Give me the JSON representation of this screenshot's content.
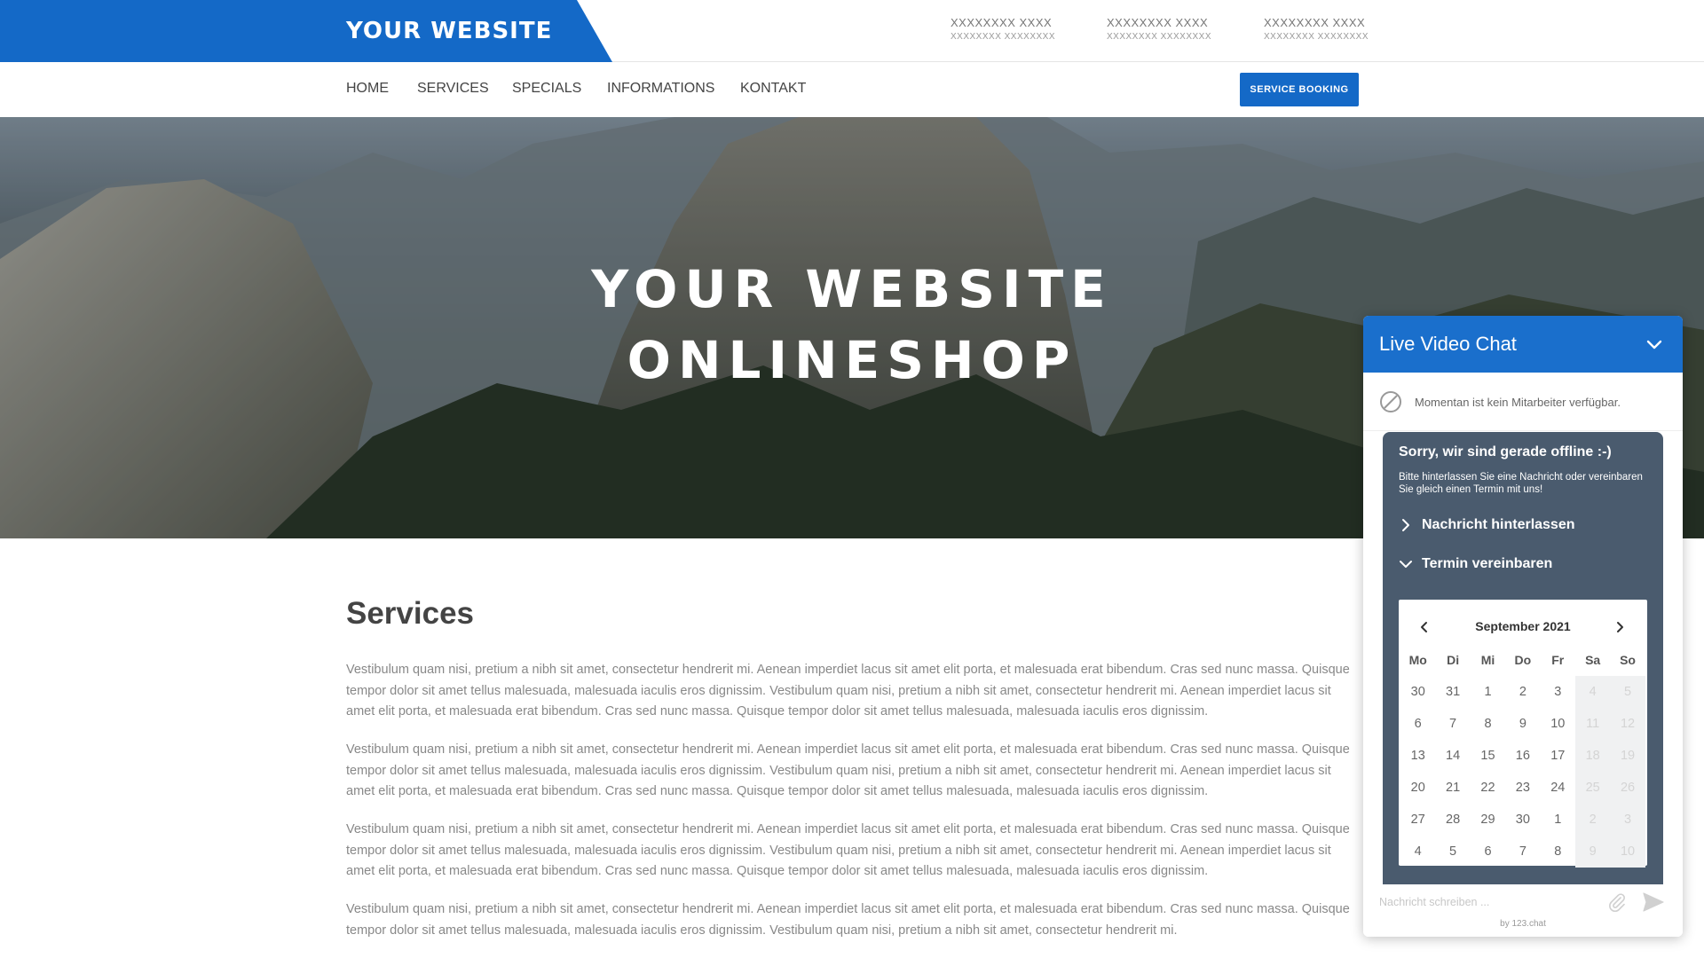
{
  "header": {
    "brand": "YOUR WEBSITE",
    "brand_color": "#1469c7",
    "contacts": [
      {
        "title": "XXXXXXXX XXXX",
        "sub": "XXXXXXXX XXXXXXXX"
      },
      {
        "title": "XXXXXXXX XXXX",
        "sub": "XXXXXXXX XXXXXXXX"
      },
      {
        "title": "XXXXXXXX XXXX",
        "sub": "XXXXXXXX XXXXXXXX"
      }
    ]
  },
  "nav": {
    "items": [
      "HOME",
      "SERVICES",
      "SPECIALS",
      "INFORMATIONS",
      "KONTAKT"
    ],
    "booking_button": "SERVICE BOOKING"
  },
  "hero": {
    "line1": "YOUR WEBSITE",
    "line2": "ONLINESHOP"
  },
  "content": {
    "title": "Services",
    "paragraphs": [
      "Vestibulum quam nisi, pretium a nibh sit amet, consectetur hendrerit mi. Aenean imperdiet lacus sit amet elit porta, et malesuada erat bibendum. Cras sed nunc massa. Quisque tempor dolor sit amet tellus malesuada, malesuada iaculis eros dignissim. Vestibulum quam nisi, pretium a nibh sit amet, consectetur hendrerit mi. Aenean imperdiet lacus sit amet elit porta, et malesuada erat bibendum. Cras sed nunc massa. Quisque tempor dolor sit amet tellus malesuada, malesuada iaculis eros dignissim.",
      "Vestibulum quam nisi, pretium a nibh sit amet, consectetur hendrerit mi. Aenean imperdiet lacus sit amet elit porta, et malesuada erat bibendum. Cras sed nunc massa. Quisque tempor dolor sit amet tellus malesuada, malesuada iaculis eros dignissim. Vestibulum quam nisi, pretium a nibh sit amet, consectetur hendrerit mi. Aenean imperdiet lacus sit amet elit porta, et malesuada erat bibendum. Cras sed nunc massa. Quisque tempor dolor sit amet tellus malesuada, malesuada iaculis eros dignissim.",
      "Vestibulum quam nisi, pretium a nibh sit amet, consectetur hendrerit mi. Aenean imperdiet lacus sit amet elit porta, et malesuada erat bibendum. Cras sed nunc massa. Quisque tempor dolor sit amet tellus malesuada, malesuada iaculis eros dignissim. Vestibulum quam nisi, pretium a nibh sit amet, consectetur hendrerit mi. Aenean imperdiet lacus sit amet elit porta, et malesuada erat bibendum. Cras sed nunc massa. Quisque tempor dolor sit amet tellus malesuada, malesuada iaculis eros dignissim.",
      "Vestibulum quam nisi, pretium a nibh sit amet, consectetur hendrerit mi. Aenean imperdiet lacus sit amet elit porta, et malesuada erat bibendum. Cras sed nunc massa. Quisque tempor dolor sit amet tellus malesuada, malesuada iaculis eros dignissim. Vestibulum quam nisi, pretium a nibh sit amet, consectetur hendrerit mi."
    ]
  },
  "chat": {
    "title": "Live Video Chat",
    "header_color": "#1a6fcc",
    "status_text": "Momentan ist kein Mitarbeiter verfügbar.",
    "offline_title": "Sorry, wir sind gerade offline :-)",
    "offline_sub": "Bitte hinterlassen Sie eine Nachricht oder vereinbaren Sie gleich einen Termin mit uns!",
    "option_message": "Nachricht hinterlassen",
    "option_appointment": "Termin vereinbaren",
    "input_placeholder": "Nachricht schreiben ...",
    "powered_by": "by 123.chat",
    "icons": [
      "chevron-down-icon",
      "unavailable-icon",
      "chevron-right-icon",
      "paperclip-icon",
      "send-icon"
    ]
  },
  "calendar": {
    "month": "September 2021",
    "weekdays": [
      "Mo",
      "Di",
      "Mi",
      "Do",
      "Fr",
      "Sa",
      "So"
    ],
    "weeks": [
      [
        "30",
        "31",
        "1",
        "2",
        "3",
        "4",
        "5"
      ],
      [
        "6",
        "7",
        "8",
        "9",
        "10",
        "11",
        "12"
      ],
      [
        "13",
        "14",
        "15",
        "16",
        "17",
        "18",
        "19"
      ],
      [
        "20",
        "21",
        "22",
        "23",
        "24",
        "25",
        "26"
      ],
      [
        "27",
        "28",
        "29",
        "30",
        "1",
        "2",
        "3"
      ],
      [
        "4",
        "5",
        "6",
        "7",
        "8",
        "9",
        "10"
      ]
    ]
  }
}
